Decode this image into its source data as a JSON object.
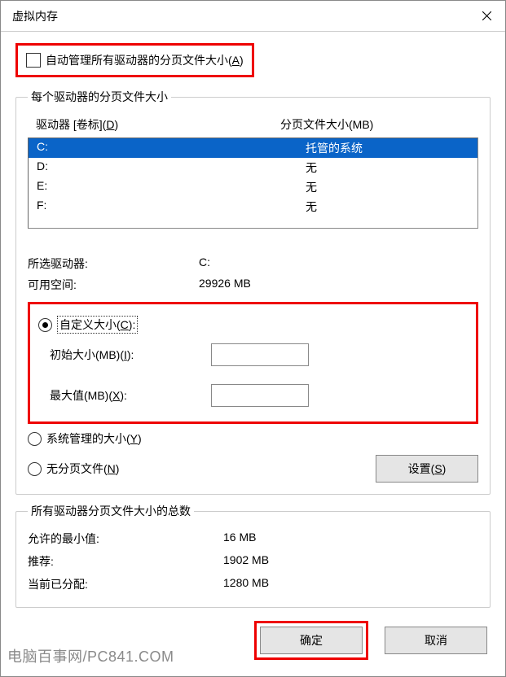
{
  "title": "虚拟内存",
  "auto_manage_label": "自动管理所有驱动器的分页文件大小",
  "auto_manage_hotkey": "A",
  "fs1": {
    "legend": "每个驱动器的分页文件大小",
    "hdr_drive": "驱动器 [卷标]",
    "hdr_drive_hotkey": "D",
    "hdr_file": "分页文件大小(MB)",
    "drives": [
      {
        "name": "C:",
        "status": "托管的系统",
        "selected": true
      },
      {
        "name": "D:",
        "status": "无",
        "selected": false
      },
      {
        "name": "E:",
        "status": "无",
        "selected": false
      },
      {
        "name": "F:",
        "status": "无",
        "selected": false
      }
    ],
    "selected_drive_label": "所选驱动器:",
    "selected_drive_value": "C:",
    "avail_label": "可用空间:",
    "avail_value": "29926 MB",
    "radio_custom": "自定义大小",
    "radio_custom_hotkey": "C",
    "initial_label": "初始大小(MB)",
    "initial_hotkey": "I",
    "max_label": "最大值(MB)",
    "max_hotkey": "X",
    "radio_system": "系统管理的大小",
    "radio_system_hotkey": "Y",
    "radio_none": "无分页文件",
    "radio_none_hotkey": "N",
    "set_btn": "设置",
    "set_btn_hotkey": "S"
  },
  "fs2": {
    "legend": "所有驱动器分页文件大小的总数",
    "min_label": "允许的最小值:",
    "min_value": "16 MB",
    "rec_label": "推荐:",
    "rec_value": "1902 MB",
    "cur_label": "当前已分配:",
    "cur_value": "1280 MB"
  },
  "ok_btn": "确定",
  "cancel_btn": "取消",
  "watermark": "电脑百事网/PC841.COM",
  "wm_right": "电脑百事网"
}
